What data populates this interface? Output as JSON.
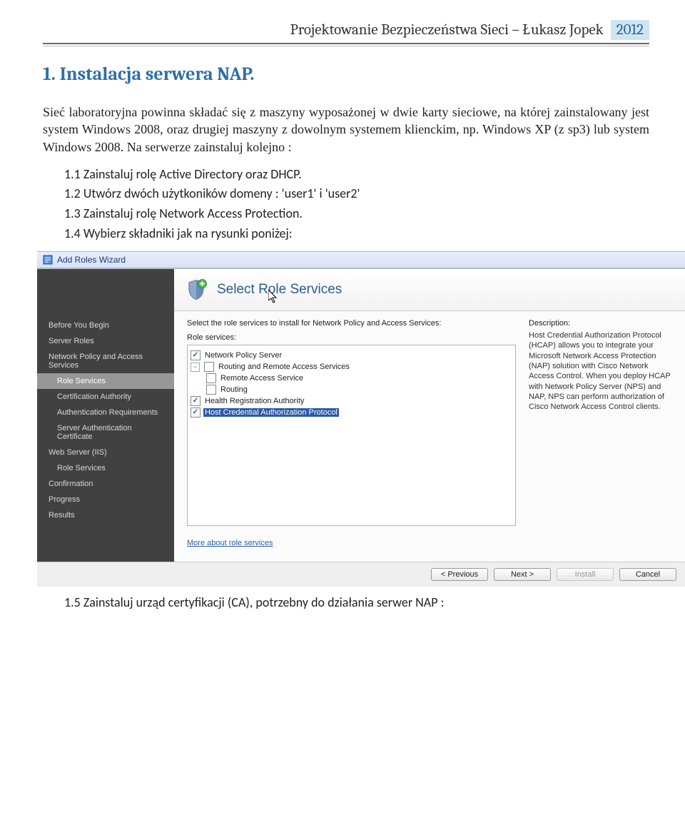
{
  "header": {
    "title": "Projektowanie Bezpieczeństwa Sieci – Łukasz Jopek",
    "year": "2012"
  },
  "h1": "1.  Instalacja serwera NAP.",
  "para": "Sieć laboratoryjna powinna składać się z maszyny wyposażonej w dwie karty sieciowe, na której zainstalowany jest system Windows 2008, oraz drugiej maszyny z dowolnym systemem klienckim, np. Windows XP (z sp3) lub system Windows 2008. Na serwerze zainstaluj kolejno :",
  "steps": [
    "1.1  Zainstaluj rolę Active Directory oraz DHCP.",
    "1.2  Utwórz dwóch użytkoników domeny : 'user1' i 'user2'",
    "1.3  Zainstaluj rolę Network Access Protection.",
    "1.4  Wybierz składniki jak na rysunki poniżej:"
  ],
  "wizard": {
    "titlebar": "Add Roles Wizard",
    "header_title": "Select Role Services",
    "sidebar": [
      {
        "label": "Before You Begin",
        "sub": false,
        "current": false
      },
      {
        "label": "Server Roles",
        "sub": false,
        "current": false
      },
      {
        "label": "Network Policy and Access Services",
        "sub": false,
        "current": false
      },
      {
        "label": "Role Services",
        "sub": true,
        "current": true
      },
      {
        "label": "Certification Authority",
        "sub": true,
        "current": false
      },
      {
        "label": "Authentication Requirements",
        "sub": true,
        "current": false
      },
      {
        "label": "Server Authentication Certificate",
        "sub": true,
        "current": false
      },
      {
        "label": "Web Server (IIS)",
        "sub": false,
        "current": false
      },
      {
        "label": "Role Services",
        "sub": true,
        "current": false
      },
      {
        "label": "Confirmation",
        "sub": false,
        "current": false
      },
      {
        "label": "Progress",
        "sub": false,
        "current": false
      },
      {
        "label": "Results",
        "sub": false,
        "current": false
      }
    ],
    "instruction": "Select the role services to install for Network Policy and Access Services:",
    "roles_label": "Role services:",
    "desc_label": "Description:",
    "tree": [
      {
        "lvl": 1,
        "chk": true,
        "label": "Network Policy Server",
        "exp": ""
      },
      {
        "lvl": 1,
        "chk": false,
        "label": "Routing and Remote Access Services",
        "exp": "-"
      },
      {
        "lvl": 2,
        "chk": false,
        "label": "Remote Access Service",
        "exp": ""
      },
      {
        "lvl": 2,
        "chk": false,
        "label": "Routing",
        "exp": ""
      },
      {
        "lvl": 1,
        "chk": true,
        "label": "Health Registration Authority",
        "exp": ""
      },
      {
        "lvl": 1,
        "chk": true,
        "label": "Host Credential Authorization Protocol",
        "exp": "",
        "selected": true
      }
    ],
    "description": "Host Credential Authorization Protocol (HCAP) allows you to integrate your Microsoft Network Access Protection (NAP) solution with Cisco Network Access Control. When you deploy HCAP with Network Policy Server (NPS) and NAP, NPS can perform authorization of Cisco Network Access Control clients.",
    "more": "More about role services",
    "buttons": {
      "prev": "< Previous",
      "next": "Next >",
      "install": "Install",
      "cancel": "Cancel"
    }
  },
  "footer_step": "1.5  Zainstaluj urząd certyfikacji (CA), potrzebny do działania serwer NAP :"
}
